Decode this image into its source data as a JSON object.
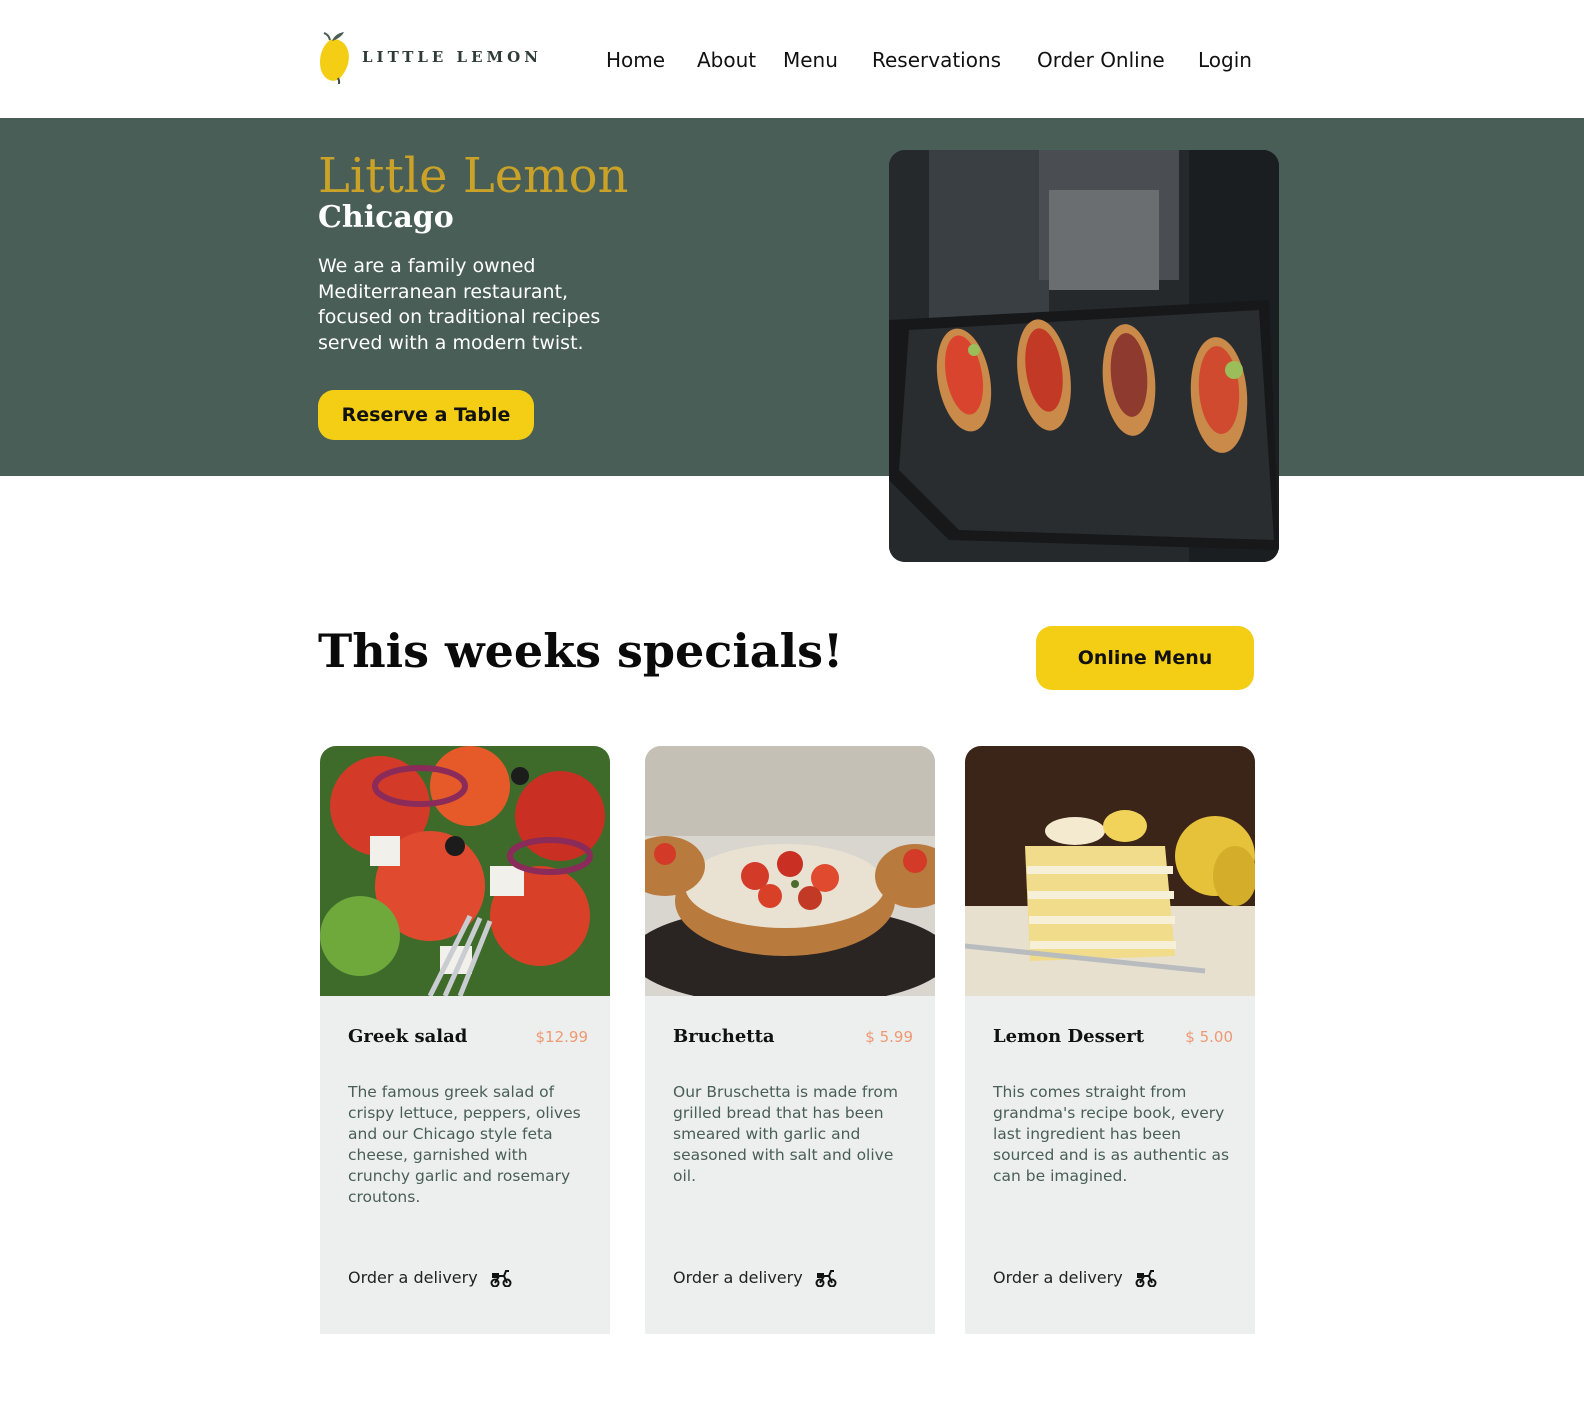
{
  "header": {
    "logo_text": "LITTLE LEMON",
    "nav": [
      {
        "label": "Home"
      },
      {
        "label": "About"
      },
      {
        "label": "Menu"
      },
      {
        "label": "Reservations"
      },
      {
        "label": "Order Online"
      },
      {
        "label": "Login"
      }
    ]
  },
  "hero": {
    "title": "Little Lemon",
    "subtitle": "Chicago",
    "description": "We are a family owned Mediterranean restaurant, focused on traditional recipes served with a modern twist.",
    "reserve_label": "Reserve a Table"
  },
  "specials": {
    "title": "This weeks specials!",
    "menu_button_label": "Online Menu",
    "cards": [
      {
        "name": "Greek salad",
        "price": "$12.99",
        "description": "The famous greek salad of crispy lettuce, peppers, olives and our Chicago style feta cheese, garnished with crunchy garlic and rosemary croutons.",
        "order_label": "Order a delivery"
      },
      {
        "name": "Bruchetta",
        "price": "$ 5.99",
        "description": "Our Bruschetta is made from grilled bread that has been smeared with garlic and seasoned with salt and olive oil.",
        "order_label": "Order a delivery"
      },
      {
        "name": "Lemon Dessert",
        "price": "$ 5.00",
        "description": "This comes straight from grandma's recipe book, every last ingredient has been sourced and is as authentic as can be imagined.",
        "order_label": "Order a delivery"
      }
    ]
  },
  "colors": {
    "primary_green": "#495e57",
    "primary_yellow": "#f4ce14",
    "title_gold": "#c9a227",
    "price_salmon": "#ee9972",
    "card_bg": "#edefee"
  }
}
